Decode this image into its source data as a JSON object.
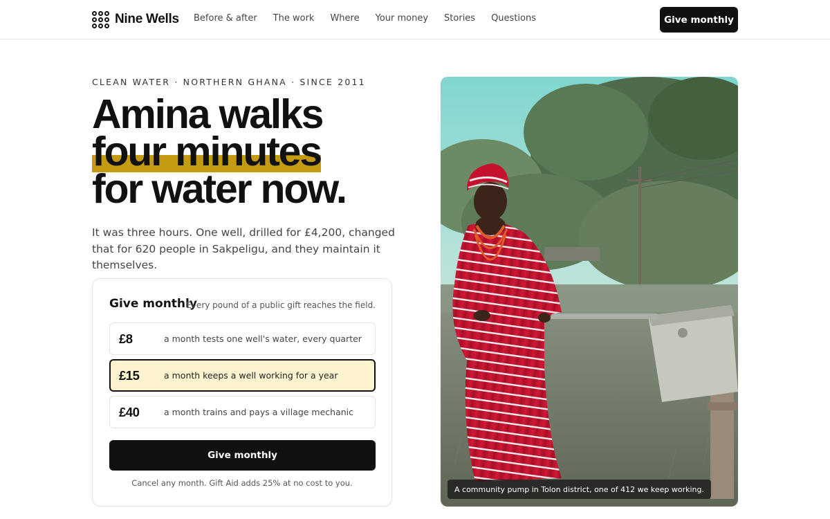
{
  "header": {
    "brand": "Nine Wells",
    "nav": [
      "Before & after",
      "The work",
      "Where",
      "Your money",
      "Stories",
      "Questions"
    ],
    "cta": "Give monthly"
  },
  "hero": {
    "eyebrow": "CLEAN WATER · NORTHERN GHANA · SINCE 2011",
    "headline": {
      "line1": "Amina walks",
      "highlight": "four minutes",
      "line3": "for water now."
    },
    "lede": "It was three hours. One well, drilled for £4,200, changed that for 620 people in Sakpeligu, and they maintain it themselves."
  },
  "give_card": {
    "title": "Give monthly",
    "note": "Every pound of a public gift reaches the field.",
    "tiers": [
      {
        "amount": "£8",
        "description": "a month tests one well's water, every quarter",
        "selected": false
      },
      {
        "amount": "£15",
        "description": "a month keeps a well working for a year",
        "selected": true
      },
      {
        "amount": "£40",
        "description": "a month trains and pays a village mechanic",
        "selected": false
      }
    ],
    "cta": "Give monthly",
    "footnote": "Cancel any month. Gift Aid adds 25% at no cost to you."
  },
  "photo": {
    "caption": "A community pump in Tolon district, one of 412 we keep working."
  },
  "colors": {
    "highlight": "#c49a10",
    "selected_tier_bg": "#fdf3cf",
    "ink": "#111111"
  }
}
